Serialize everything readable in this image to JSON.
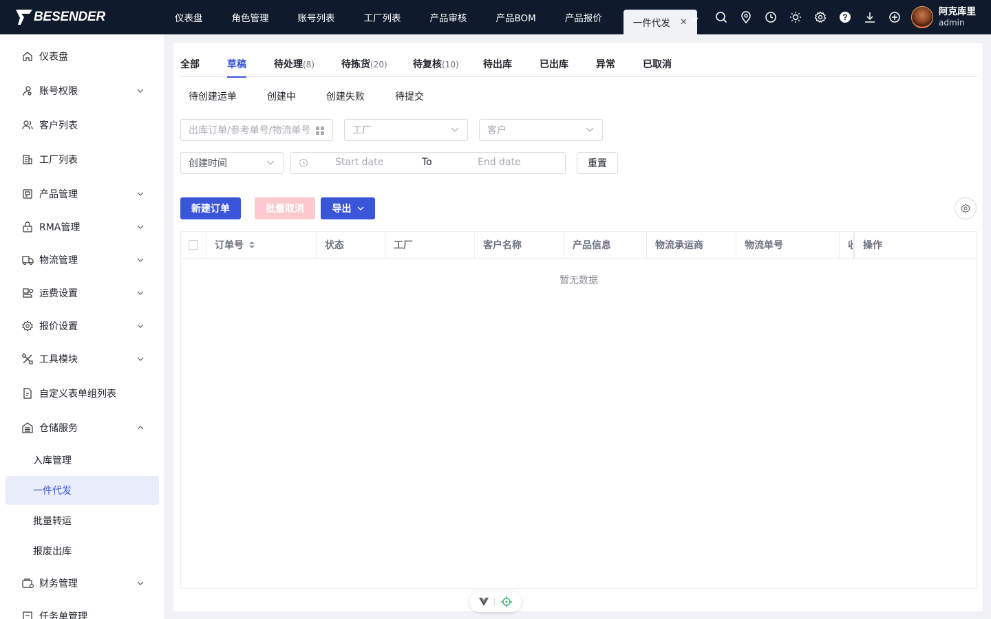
{
  "brand": {
    "name": "BESENDER"
  },
  "top_nav": {
    "tabs": [
      "仪表盘",
      "角色管理",
      "账号列表",
      "工厂列表",
      "产品审核",
      "产品BOM",
      "产品报价"
    ],
    "active_tab": "一件代发",
    "close_glyph": "✕"
  },
  "top_icons": [
    "search-icon",
    "location-icon",
    "clock-icon",
    "sun-icon",
    "gear-icon",
    "help-icon",
    "download-icon",
    "plus-circle-icon"
  ],
  "user": {
    "name": "阿克库里",
    "role": "admin"
  },
  "sidebar": {
    "items": [
      {
        "label": "仪表盘",
        "icon": "home-icon",
        "expandable": false
      },
      {
        "label": "账号权限",
        "icon": "user-key-icon",
        "expandable": true
      },
      {
        "label": "客户列表",
        "icon": "users-icon",
        "expandable": false
      },
      {
        "label": "工厂列表",
        "icon": "factory-icon",
        "expandable": false
      },
      {
        "label": "产品管理",
        "icon": "product-icon",
        "expandable": true
      },
      {
        "label": "RMA管理",
        "icon": "lock-box-icon",
        "expandable": true
      },
      {
        "label": "物流管理",
        "icon": "truck-icon",
        "expandable": true
      },
      {
        "label": "运费设置",
        "icon": "freight-icon",
        "expandable": true
      },
      {
        "label": "报价设置",
        "icon": "settings-icon",
        "expandable": true
      },
      {
        "label": "工具模块",
        "icon": "tools-icon",
        "expandable": true
      },
      {
        "label": "自定义表单组列表",
        "icon": "form-icon",
        "expandable": false
      },
      {
        "label": "仓储服务",
        "icon": "warehouse-icon",
        "expandable": true,
        "expanded": true
      }
    ],
    "sub_items": [
      "入库管理",
      "一件代发",
      "批量转运",
      "报废出库"
    ],
    "active_sub": "一件代发",
    "after_items": [
      {
        "label": "财务管理",
        "icon": "finance-icon",
        "expandable": true
      },
      {
        "label": "任务单管理",
        "icon": "task-icon",
        "expandable": false
      }
    ]
  },
  "status_tabs": [
    {
      "label": "全部",
      "count": ""
    },
    {
      "label": "草稿",
      "count": ""
    },
    {
      "label": "待处理",
      "count": "(8)"
    },
    {
      "label": "待拣货",
      "count": "(20)"
    },
    {
      "label": "待复核",
      "count": "(10)"
    },
    {
      "label": "待出库",
      "count": ""
    },
    {
      "label": "已出库",
      "count": ""
    },
    {
      "label": "异常",
      "count": ""
    },
    {
      "label": "已取消",
      "count": ""
    }
  ],
  "active_status_tab": "草稿",
  "sub_tabs": [
    "待创建运单",
    "创建中",
    "创建失败",
    "待提交"
  ],
  "filters": {
    "search_placeholder": "出库订单/参考单号/物流单号",
    "factory_placeholder": "工厂",
    "customer_placeholder": "客户",
    "time_type": "创建时间",
    "start_placeholder": "Start date",
    "range_separator": "To",
    "end_placeholder": "End date",
    "reset_label": "重置"
  },
  "actions": {
    "new_order": "新建订单",
    "batch_cancel": "批量取消",
    "export": "导出"
  },
  "table": {
    "columns": [
      "订单号",
      "状态",
      "工厂",
      "客户名称",
      "产品信息",
      "物流承运商",
      "物流单号",
      "收",
      "操作"
    ],
    "empty_text": "暂无数据"
  },
  "colors": {
    "primary": "#3a55d8",
    "topbar": "#0f1b2d",
    "disabled_danger": "#fbc9ce",
    "active_bg": "#e8ecfb"
  }
}
